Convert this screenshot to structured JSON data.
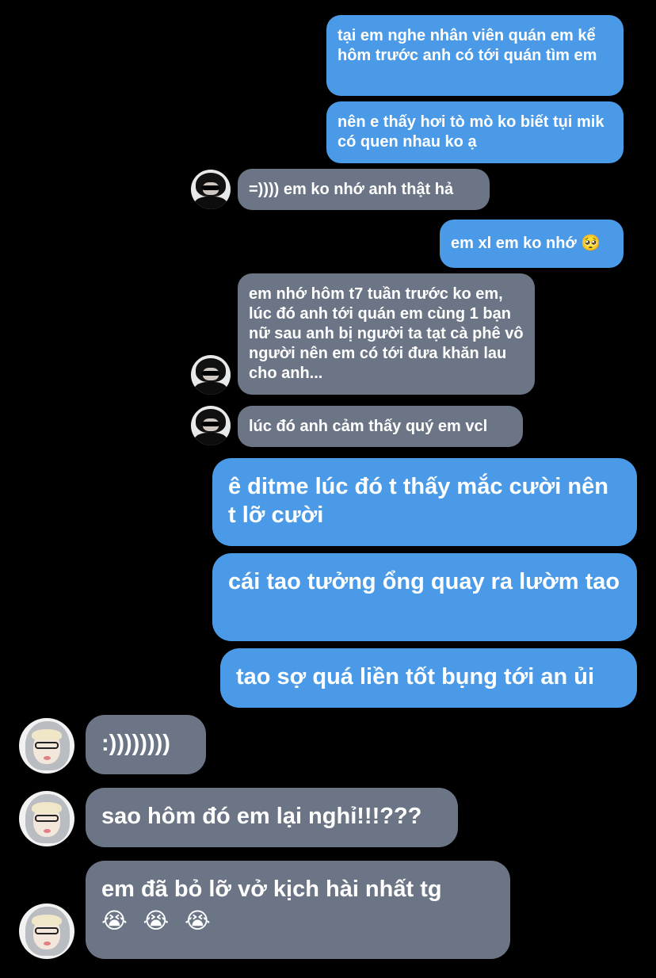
{
  "messages": [
    {
      "side": "out",
      "text": "tại em nghe nhân viên quán em kể hôm trước anh có tới quán tìm em"
    },
    {
      "side": "out",
      "text": "nên e thấy hơi tò mò ko biết tụi mik có quen nhau ko ạ"
    },
    {
      "side": "in",
      "text": "=)))) em ko nhớ anh thật hả"
    },
    {
      "side": "out",
      "text": "em xl em ko nhớ 🥺"
    },
    {
      "side": "in",
      "text": "em nhớ hôm t7 tuần trước ko em, lúc đó anh tới quán em cùng 1 bạn nữ sau anh bị người ta tạt cà phê vô người nên em có tới đưa khăn lau cho anh..."
    },
    {
      "side": "in",
      "text": "lúc đó anh cảm thấy quý em vcl"
    },
    {
      "side": "out",
      "text": "ê ditme lúc đó t thấy mắc cười nên t lỡ cười"
    },
    {
      "side": "out",
      "text": "cái tao tưởng ổng quay ra lườm tao"
    },
    {
      "side": "out",
      "text": "tao sợ quá liền tốt bụng tới an ủi"
    },
    {
      "side": "in",
      "text": ":))))))))"
    },
    {
      "side": "in",
      "text": "sao hôm đó em lại nghỉ!!!???"
    },
    {
      "side": "in",
      "text": "em đã bỏ lỡ vở kịch hài nhất tg",
      "emoji": "😭 😭 😭"
    }
  ],
  "colors": {
    "outgoing": "#4a9ae8",
    "incoming": "#6b7585",
    "background": "#000000"
  },
  "avatars": {
    "upper_contact": "dark-hair-sunglasses-avatar",
    "lower_contact": "hooded-glasses-avatar"
  }
}
